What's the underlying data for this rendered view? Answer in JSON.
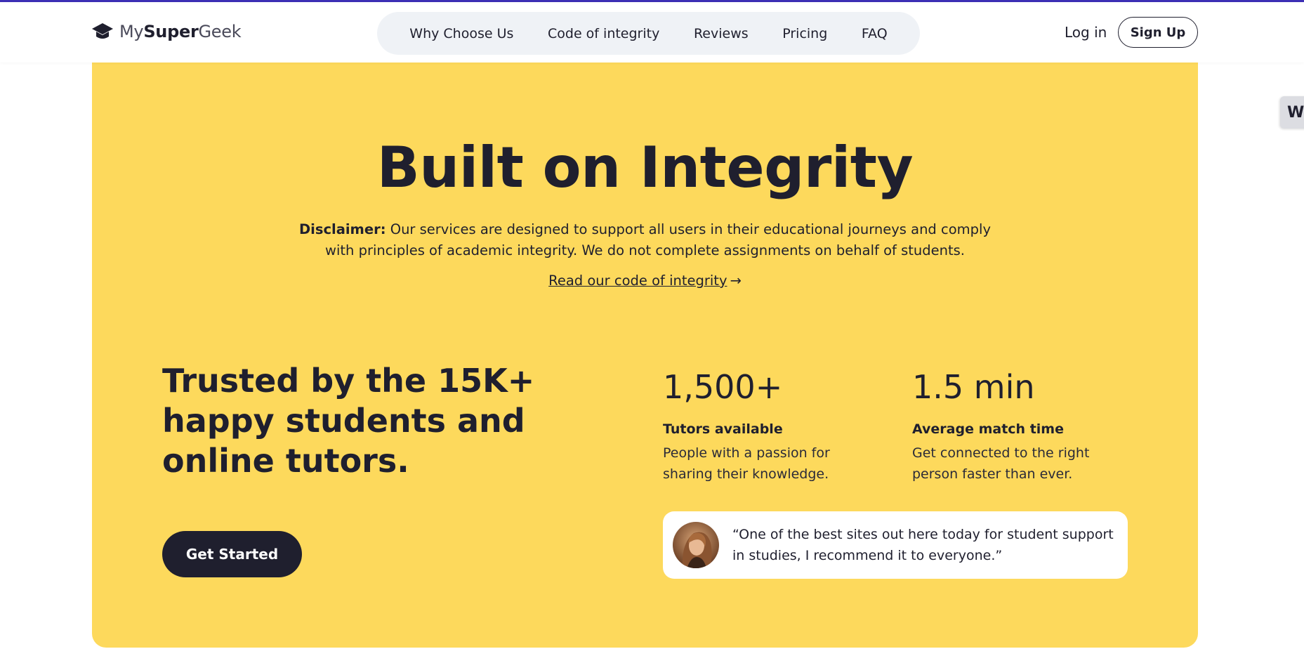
{
  "brand": {
    "logo_prefix": "My",
    "logo_bold": "Super",
    "logo_suffix": "Geek",
    "accent_stripe_color": "#3c2fb5"
  },
  "nav": {
    "items": [
      {
        "label": "Why Choose Us"
      },
      {
        "label": "Code of integrity"
      },
      {
        "label": "Reviews"
      },
      {
        "label": "Pricing"
      },
      {
        "label": "FAQ"
      }
    ],
    "login_label": "Log in",
    "signup_label": "Sign Up"
  },
  "hero": {
    "title": "Built on Integrity",
    "disclaimer_label": "Disclaimer:",
    "disclaimer_text": " Our services are designed to support all users in their educational journeys and comply with principles of academic integrity. We do not complete assignments on behalf of students.",
    "read_link_label": "Read our code of integrity",
    "read_link_arrow": "→",
    "background_color": "#fdd95c"
  },
  "trusted": {
    "headline": "Trusted by the 15K+ happy students and online tutors.",
    "cta_label": "Get Started"
  },
  "stats": [
    {
      "value": "1,500+",
      "label": "Tutors available",
      "description": "People with a passion for sharing their knowledge."
    },
    {
      "value": "1.5 min",
      "label": "Average match time",
      "description": "Get connected to the right person faster than ever."
    }
  ],
  "testimonial": {
    "quote": "“One of the best sites out here today for student support in studies, I recommend it to everyone.”",
    "avatar_icon": "avatar-photo"
  },
  "side_tab": {
    "label": "W"
  }
}
